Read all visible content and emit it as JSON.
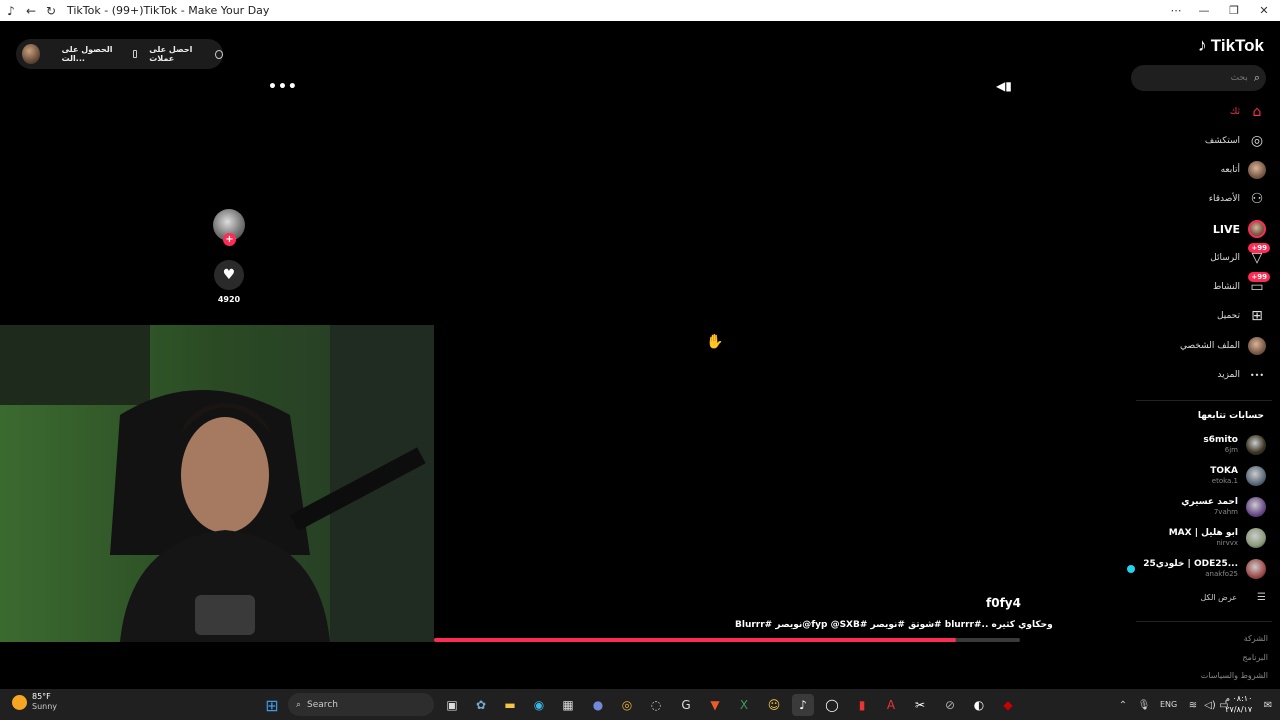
{
  "window": {
    "title": "TikTok - (99+)TikTok - Make Your Day"
  },
  "top_pill": {
    "coins_label": "احصل على عملات",
    "app_label": "الحصول على الت..."
  },
  "sidebar": {
    "logo": "TikTok",
    "search_placeholder": "بحث",
    "nav": [
      {
        "label": "ثك",
        "icon": "home-icon",
        "active": true
      },
      {
        "label": "استكشف",
        "icon": "compass-icon"
      },
      {
        "label": "أتابعه",
        "icon": "avatar-icon"
      },
      {
        "label": "الأصدقاء",
        "icon": "friends-icon"
      },
      {
        "label": "LIVE",
        "icon": "live-avatar-icon"
      },
      {
        "label": "الرسائل",
        "icon": "messages-icon",
        "badge": "+99"
      },
      {
        "label": "النشاط",
        "icon": "activity-icon",
        "badge": "+99"
      },
      {
        "label": "تحميل",
        "icon": "upload-icon"
      },
      {
        "label": "الملف الشخصي",
        "icon": "profile-avatar-icon"
      },
      {
        "label": "المزيد",
        "icon": "more-icon"
      }
    ],
    "following_title": "حسابات تتابعها",
    "accounts": [
      {
        "name": "s6mito",
        "handle": "6jm"
      },
      {
        "name": "TOKA",
        "handle": "etoka.1"
      },
      {
        "name": "احمد عسيري",
        "handle": "7vahm"
      },
      {
        "name": "MAX | ابو هليل",
        "handle": "nirvvx"
      },
      {
        "name": "خلودي25 | ODE25...",
        "handle": "anakfo25"
      }
    ],
    "see_all": "عرض الكل",
    "footer": [
      "الشركة",
      "البرنامج",
      "الشروط والسياسات"
    ]
  },
  "video": {
    "like_count": "4920",
    "author": "f0fy4",
    "caption": "وحكاوي كثيره ..#blurrr #شوتق #نويصر #fyp @SXB@نويصر #Blurrr",
    "progress": 0.89
  },
  "taskbar": {
    "weather_temp": "85°F",
    "weather_desc": "Sunny",
    "search_label": "Search",
    "lang": "ENG",
    "time": "٠٨:١٠ م",
    "date": "٢٧/٨/١٧"
  }
}
